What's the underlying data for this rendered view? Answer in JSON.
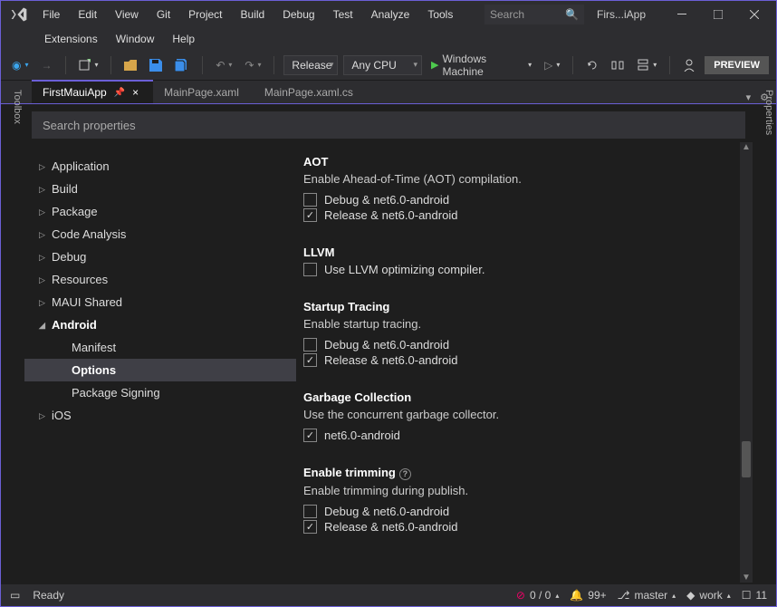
{
  "menus": {
    "row1": [
      "File",
      "Edit",
      "View",
      "Git",
      "Project",
      "Build",
      "Debug",
      "Test",
      "Analyze",
      "Tools"
    ],
    "row2": [
      "Extensions",
      "Window",
      "Help"
    ]
  },
  "search_placeholder": "Search",
  "app_title": "Firs...iApp",
  "toolbar": {
    "config": "Release",
    "platform": "Any CPU",
    "target": "Windows Machine",
    "preview": "PREVIEW"
  },
  "tabs": {
    "t0": "FirstMauiApp",
    "t1": "MainPage.xaml",
    "t2": "MainPage.xaml.cs"
  },
  "sidetabs": {
    "left": "Toolbox",
    "right": "Properties"
  },
  "props_search": "Search properties",
  "tree": {
    "application": "Application",
    "build": "Build",
    "package": "Package",
    "code_analysis": "Code Analysis",
    "debug": "Debug",
    "resources": "Resources",
    "maui_shared": "MAUI Shared",
    "android": "Android",
    "manifest": "Manifest",
    "options": "Options",
    "package_signing": "Package Signing",
    "ios": "iOS"
  },
  "sections": {
    "aot": {
      "title": "AOT",
      "desc": "Enable Ahead-of-Time (AOT) compilation.",
      "c1": "Debug & net6.0-android",
      "c2": "Release & net6.0-android"
    },
    "llvm": {
      "title": "LLVM",
      "c1": "Use LLVM optimizing compiler."
    },
    "tracing": {
      "title": "Startup Tracing",
      "desc": "Enable startup tracing.",
      "c1": "Debug & net6.0-android",
      "c2": "Release & net6.0-android"
    },
    "gc": {
      "title": "Garbage Collection",
      "desc": "Use the concurrent garbage collector.",
      "c1": "net6.0-android"
    },
    "trim": {
      "title": "Enable trimming",
      "desc": "Enable trimming during publish.",
      "c1": "Debug & net6.0-android",
      "c2": "Release & net6.0-android"
    }
  },
  "status": {
    "ready": "Ready",
    "errors": "0 / 0",
    "notif": "99+",
    "branch": "master",
    "work": "work",
    "ln": "11"
  }
}
